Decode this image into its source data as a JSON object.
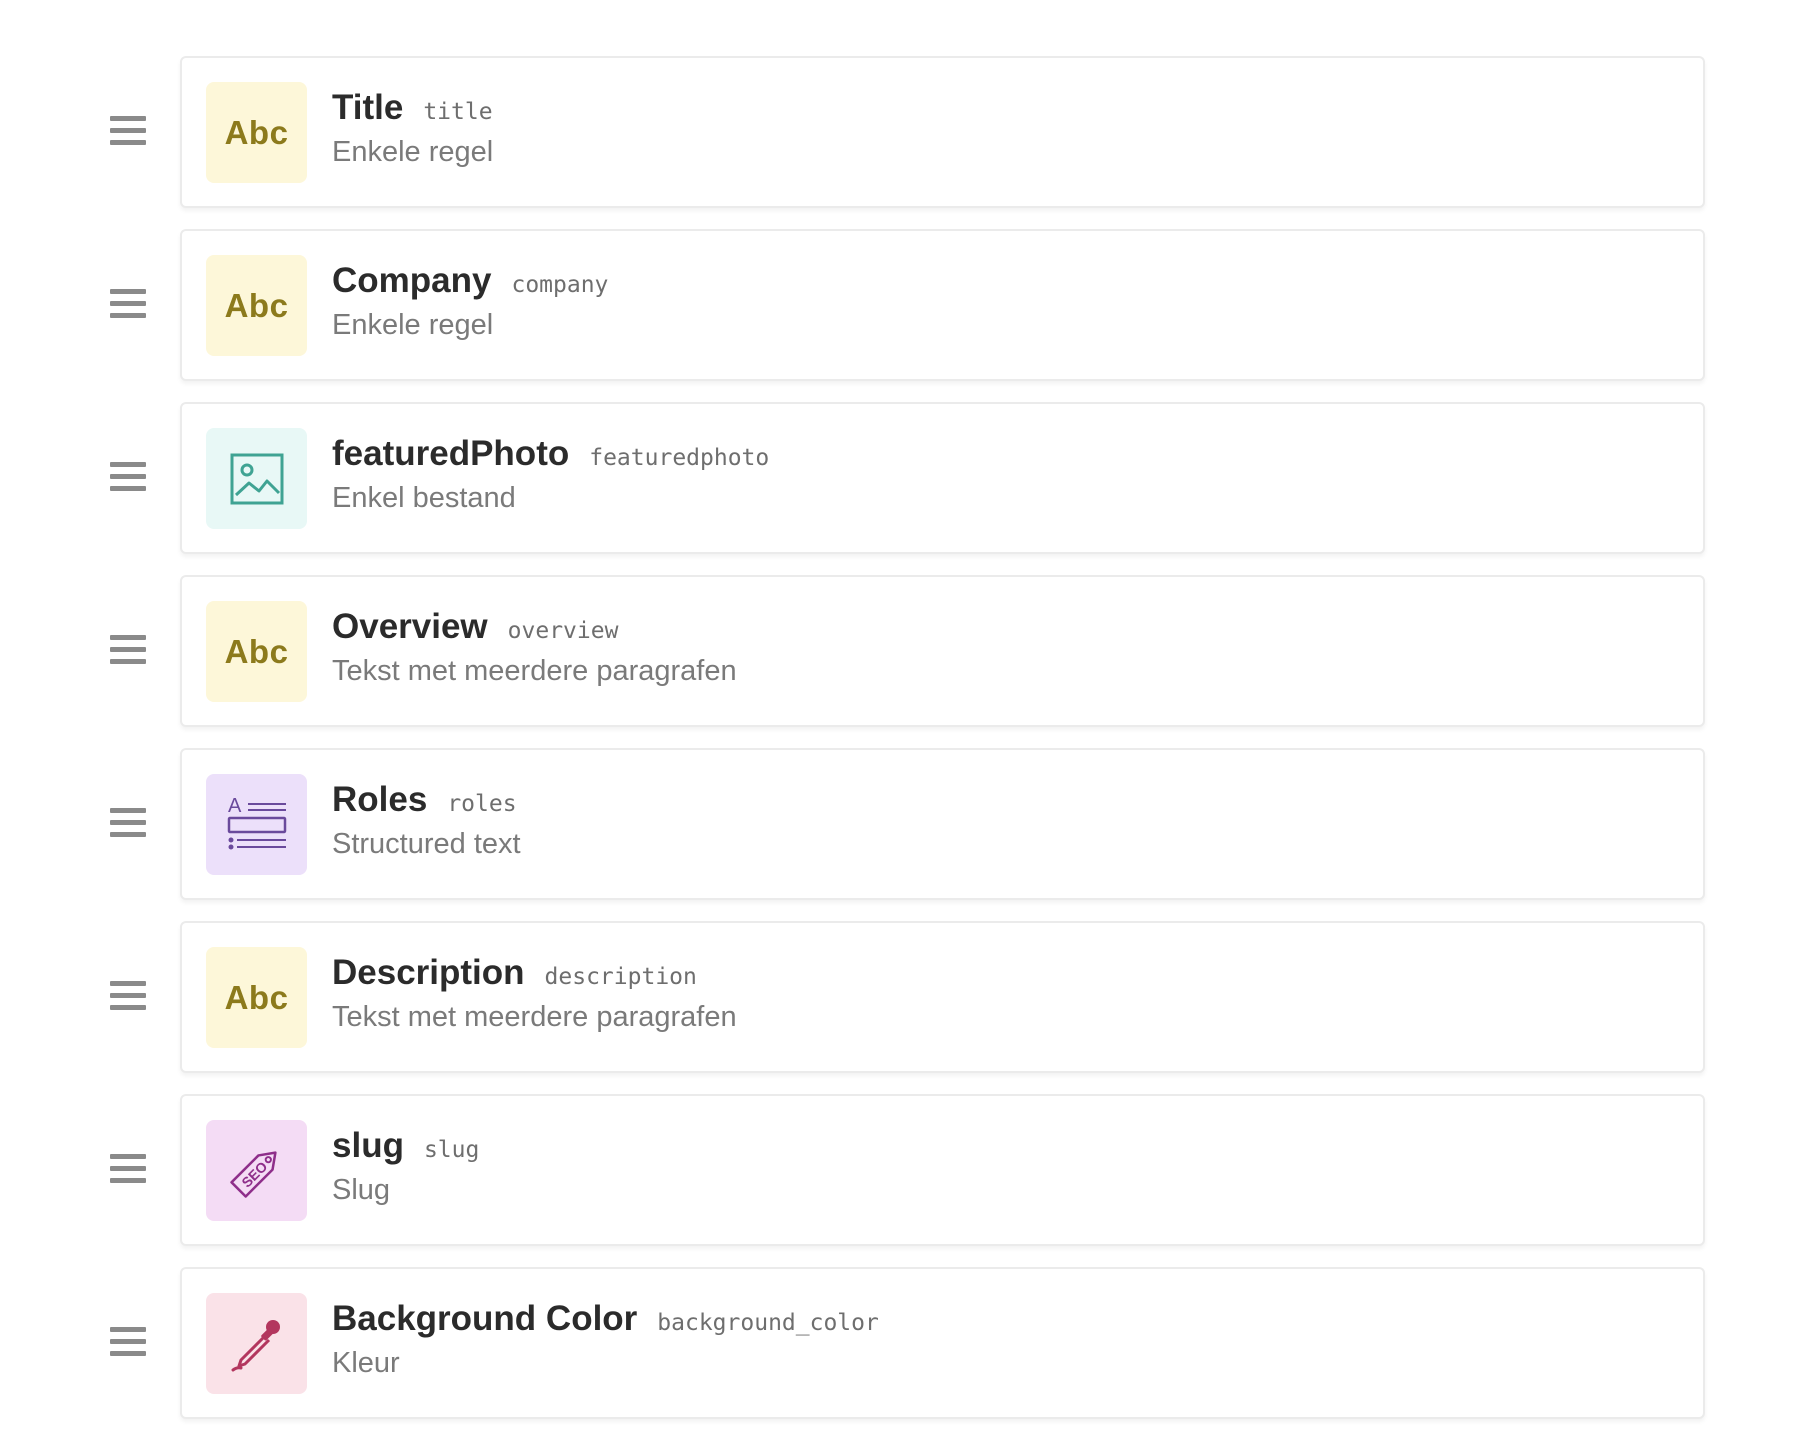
{
  "colors": {
    "text_yellow": "#8c7a1c",
    "bg_yellow": "#fdf7d9",
    "media_stroke": "#3fa393",
    "bg_media": "#e8f8f6",
    "structured_stroke": "#6a4a9c",
    "bg_structured": "#ece0fa",
    "seo_stroke": "#8e2e8a",
    "bg_seo": "#f4dcf5",
    "color_stroke": "#b3365e",
    "bg_color": "#fae2e8"
  },
  "fields": [
    {
      "label": "Title",
      "api_key": "title",
      "type": "Enkele regel",
      "icon": "abc-icon",
      "icon_text": "Abc"
    },
    {
      "label": "Company",
      "api_key": "company",
      "type": "Enkele regel",
      "icon": "abc-icon",
      "icon_text": "Abc"
    },
    {
      "label": "featuredPhoto",
      "api_key": "featuredphoto",
      "type": "Enkel bestand",
      "icon": "image-icon"
    },
    {
      "label": "Overview",
      "api_key": "overview",
      "type": "Tekst met meerdere paragrafen",
      "icon": "abc-icon",
      "icon_text": "Abc"
    },
    {
      "label": "Roles",
      "api_key": "roles",
      "type": "Structured text",
      "icon": "structured-text-icon"
    },
    {
      "label": "Description",
      "api_key": "description",
      "type": "Tekst met meerdere paragrafen",
      "icon": "abc-icon",
      "icon_text": "Abc"
    },
    {
      "label": "slug",
      "api_key": "slug",
      "type": "Slug",
      "icon": "seo-tag-icon",
      "icon_text": "SEO"
    },
    {
      "label": "Background Color",
      "api_key": "background_color",
      "type": "Kleur",
      "icon": "eyedropper-icon"
    }
  ]
}
